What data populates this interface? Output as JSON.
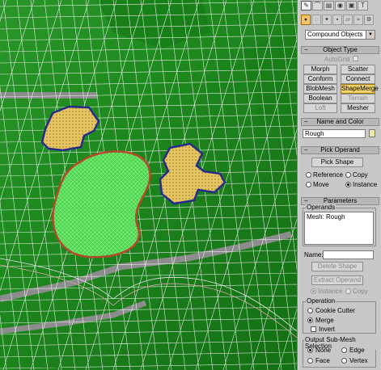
{
  "colors": {
    "terrain": "#1f8a1f",
    "rough_fill": "#e7c561",
    "rough_outline": "#2a2a8c",
    "green_fill": "#55e055",
    "green_outline": "#b54a2a",
    "cart_path": "#8c8c8c",
    "mesh": "#ffffff",
    "panel_bg": "#c8c8c8",
    "active_button": "#f2d26a"
  },
  "command_tabs": [
    "create-icon",
    "modify-icon",
    "hierarchy-icon",
    "motion-icon",
    "display-icon",
    "utilities-icon"
  ],
  "category_tabs": [
    "geometry-icon",
    "shapes-icon",
    "lights-icon",
    "cameras-icon",
    "helpers-icon",
    "spacewarps-icon",
    "systems-icon"
  ],
  "category_dropdown": {
    "value": "Compound Objects"
  },
  "object_type": {
    "title": "Object Type",
    "autogrid_label": "AutoGrid",
    "buttons": [
      {
        "label": "Morph"
      },
      {
        "label": "Scatter"
      },
      {
        "label": "Conform"
      },
      {
        "label": "Connect"
      },
      {
        "label": "BlobMesh"
      },
      {
        "label": "ShapeMerge"
      },
      {
        "label": "Boolean"
      },
      {
        "label": "Terrain"
      },
      {
        "label": "Loft"
      },
      {
        "label": "Mesher"
      }
    ]
  },
  "name_and_color": {
    "title": "Name and Color",
    "name_value": "Rough",
    "color": "#e9e9a8"
  },
  "pick_operand": {
    "title": "Pick Operand",
    "pick_shape_label": "Pick Shape",
    "reference_label": "Reference",
    "copy_label": "Copy",
    "move_label": "Move",
    "instance_label": "Instance",
    "selected": "Instance"
  },
  "parameters": {
    "title": "Parameters",
    "operands_title": "Operands",
    "operands": [
      "Mesh: Rough"
    ],
    "name_label": "Name:",
    "name_value": "",
    "delete_shape_label": "Delete Shape",
    "extract_operand_label": "Extract Operand",
    "instance_label": "Instance",
    "copy_label": "Copy",
    "operation_title": "Operation",
    "cookie_cutter_label": "Cookie Cutter",
    "merge_label": "Merge",
    "invert_label": "Invert",
    "operation_selected": "Merge",
    "sub_mesh_title": "Output Sub-Mesh Selection",
    "none_label": "None",
    "edge_label": "Edge",
    "face_label": "Face",
    "vertex_label": "Vertex",
    "sub_mesh_selected": "None"
  }
}
